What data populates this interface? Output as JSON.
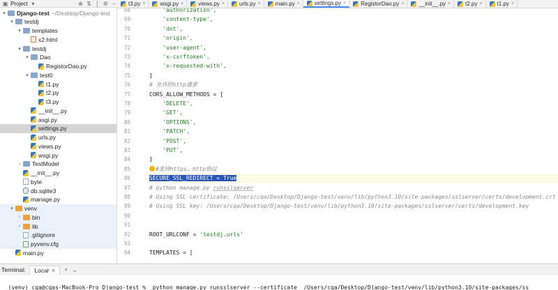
{
  "project_header": {
    "label": "Project",
    "icons": [
      "chevron-down-icon",
      "add-icon",
      "collapse-icon",
      "divider-icon",
      "gear-icon",
      "minimize-icon"
    ]
  },
  "tabs": [
    {
      "label": "t3.py",
      "active": false
    },
    {
      "label": "wsgi.py",
      "active": false
    },
    {
      "label": "views.py",
      "active": false
    },
    {
      "label": "urls.py",
      "active": false
    },
    {
      "label": "main.py",
      "active": false
    },
    {
      "label": "settings.py",
      "active": true
    },
    {
      "label": "RegistorDao.py",
      "active": false
    },
    {
      "label": "__init__.py",
      "active": false
    },
    {
      "label": "t2.py",
      "active": false
    },
    {
      "label": "t1.py",
      "active": false
    }
  ],
  "tree": [
    {
      "label": "Django-test",
      "path": "~/Desktop/Django-test",
      "indent": 0,
      "arrow": "open",
      "kind": "folder",
      "root": true
    },
    {
      "label": "testdj",
      "indent": 1,
      "arrow": "open",
      "kind": "folder"
    },
    {
      "label": "templates",
      "indent": 2,
      "arrow": "open",
      "kind": "folder"
    },
    {
      "label": "x2.html",
      "indent": 3,
      "arrow": "",
      "kind": "html"
    },
    {
      "label": "testdj",
      "indent": 2,
      "arrow": "open",
      "kind": "folder"
    },
    {
      "label": "Dao",
      "indent": 3,
      "arrow": "open",
      "kind": "folder"
    },
    {
      "label": "RegistorDao.py",
      "indent": 4,
      "arrow": "",
      "kind": "py"
    },
    {
      "label": "test0",
      "indent": 3,
      "arrow": "open",
      "kind": "folder"
    },
    {
      "label": "t1.py",
      "indent": 4,
      "arrow": "",
      "kind": "py"
    },
    {
      "label": "t2.py",
      "indent": 4,
      "arrow": "",
      "kind": "py"
    },
    {
      "label": "t3.py",
      "indent": 4,
      "arrow": "",
      "kind": "py"
    },
    {
      "label": "__init__.py",
      "indent": 3,
      "arrow": "",
      "kind": "py"
    },
    {
      "label": "asgi.py",
      "indent": 3,
      "arrow": "",
      "kind": "py"
    },
    {
      "label": "settings.py",
      "indent": 3,
      "arrow": "",
      "kind": "py",
      "selected": true
    },
    {
      "label": "urls.py",
      "indent": 3,
      "arrow": "",
      "kind": "py"
    },
    {
      "label": "views.py",
      "indent": 3,
      "arrow": "",
      "kind": "py"
    },
    {
      "label": "wsgi.py",
      "indent": 3,
      "arrow": "",
      "kind": "py"
    },
    {
      "label": "TestModel",
      "indent": 2,
      "arrow": "closed",
      "kind": "folder"
    },
    {
      "label": "__init__.py",
      "indent": 2,
      "arrow": "",
      "kind": "py"
    },
    {
      "label": "byte",
      "indent": 2,
      "arrow": "",
      "kind": "text"
    },
    {
      "label": "db.sqlite3",
      "indent": 2,
      "arrow": "",
      "kind": "db"
    },
    {
      "label": "manage.py",
      "indent": 2,
      "arrow": "",
      "kind": "py"
    },
    {
      "label": "venv",
      "indent": 1,
      "arrow": "open",
      "kind": "folder-orange",
      "venv": true
    },
    {
      "label": "bin",
      "indent": 2,
      "arrow": "closed",
      "kind": "folder-orange",
      "venv": true
    },
    {
      "label": "lib",
      "indent": 2,
      "arrow": "closed",
      "kind": "folder-orange",
      "venv": true
    },
    {
      "label": ".gitignore",
      "indent": 2,
      "arrow": "",
      "kind": "text",
      "venv": true
    },
    {
      "label": "pyvenv.cfg",
      "indent": 2,
      "arrow": "",
      "kind": "cfg",
      "venv": true
    },
    {
      "label": "main.py",
      "indent": 1,
      "arrow": "",
      "kind": "py"
    }
  ],
  "editor": {
    "lines": [
      {
        "n": "68",
        "segs": [
          [
            "str",
            "    'authorization',"
          ]
        ]
      },
      {
        "n": "69",
        "segs": [
          [
            "str",
            "    'content-type',"
          ]
        ]
      },
      {
        "n": "70",
        "segs": [
          [
            "str",
            "    'dnt',"
          ]
        ]
      },
      {
        "n": "71",
        "segs": [
          [
            "str",
            "    'origin',"
          ]
        ]
      },
      {
        "n": "72",
        "segs": [
          [
            "str",
            "    'user-agent',"
          ]
        ]
      },
      {
        "n": "73",
        "segs": [
          [
            "str",
            "    'x-csrftoken',"
          ]
        ]
      },
      {
        "n": "74",
        "segs": [
          [
            "str",
            "    'x-requested-with',"
          ]
        ]
      },
      {
        "n": "75",
        "segs": [
          [
            "txt",
            "]"
          ]
        ]
      },
      {
        "n": "76",
        "segs": [
          [
            "cmt",
            "# 允许的http请求"
          ]
        ]
      },
      {
        "n": "77",
        "segs": [
          [
            "txt",
            "CORS_ALLOW_METHODS = ["
          ]
        ]
      },
      {
        "n": "78",
        "segs": [
          [
            "str",
            "    'DELETE',"
          ]
        ]
      },
      {
        "n": "79",
        "segs": [
          [
            "str",
            "    'GET',"
          ]
        ]
      },
      {
        "n": "80",
        "segs": [
          [
            "str",
            "    'OPTIONS',"
          ]
        ]
      },
      {
        "n": "81",
        "segs": [
          [
            "str",
            "    'PATCH',"
          ]
        ]
      },
      {
        "n": "82",
        "segs": [
          [
            "str",
            "    'POST',"
          ]
        ]
      },
      {
        "n": "83",
        "segs": [
          [
            "str",
            "    'PUT',"
          ]
        ]
      },
      {
        "n": "84",
        "segs": [
          [
            "txt",
            "]"
          ]
        ]
      },
      {
        "n": "85",
        "segs": [
          [
            "bulb",
            ""
          ],
          [
            "cmt",
            "#支持https、http协议"
          ]
        ]
      },
      {
        "n": "86",
        "segs": [
          [
            "sel",
            "SECURE_SSL_REDIRECT = True"
          ]
        ],
        "highlight": true
      },
      {
        "n": "87",
        "segs": [
          [
            "cmt",
            "# python manage.py "
          ],
          [
            "cmtul",
            "runsslserver"
          ]
        ]
      },
      {
        "n": "88",
        "segs": [
          [
            "cmt",
            "# Using SSL certificate: /Users/cqa/Desktop/Django-test/venv/lib/python3.10/site-packages/sslserver/certs/development.crt"
          ]
        ]
      },
      {
        "n": "89",
        "segs": [
          [
            "cmt",
            "# Using SSL key: /Users/cqa/Desktop/Django-test/venv/lib/python3.10/site-packages/sslserver/certs/development.key"
          ]
        ]
      },
      {
        "n": "90",
        "segs": [
          [
            "txt",
            ""
          ]
        ]
      },
      {
        "n": "91",
        "segs": [
          [
            "txt",
            ""
          ]
        ]
      },
      {
        "n": "92",
        "segs": [
          [
            "txt",
            "ROOT_URLCONF = "
          ],
          [
            "str",
            "'testdj.urls'"
          ]
        ]
      },
      {
        "n": "93",
        "segs": [
          [
            "txt",
            ""
          ]
        ]
      },
      {
        "n": "94",
        "segs": [
          [
            "txt",
            "TEMPLATES = ["
          ]
        ]
      }
    ]
  },
  "terminal": {
    "label": "Terminal:",
    "tab": "Local",
    "icons": [
      "close-icon",
      "add-icon",
      "chevron-down-icon"
    ],
    "command": "(venv) cqa@cqas-MacBook-Pro Django-test %  python manage.py runsslserver --certificate  /Users/cqa/Desktop/Django-test/venv/lib/python3.10/site-packages/ss"
  },
  "colors": {
    "accent": "#4a8ef7",
    "selection": "#2a55b5",
    "string": "#227a22",
    "comment": "#8a8a8a"
  }
}
